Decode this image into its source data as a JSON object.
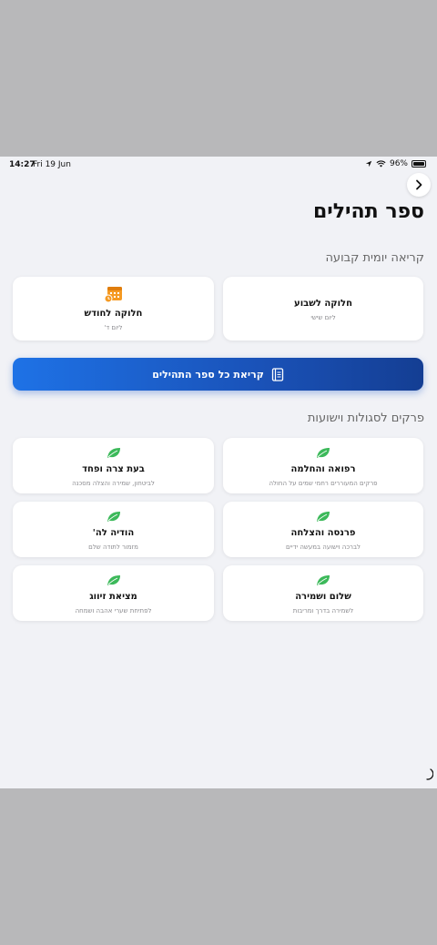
{
  "status": {
    "time": "14:27",
    "date": "Fri 19 Jun",
    "battery": "96%",
    "battery_level": 0.96
  },
  "header": {
    "title": "ספר תהילים"
  },
  "fixed_reading": {
    "title": "קריאה יומית קבועה",
    "cards": [
      {
        "title": "חלוקה לשבוע",
        "subtitle": "ליום שישי"
      },
      {
        "title": "חלוקה לחודש",
        "subtitle": "ליום ד'",
        "icon": "calendar-icon"
      }
    ]
  },
  "read_all": {
    "label": "קריאת כל ספר התהילים",
    "icon": "book-icon",
    "color_start": "#1e72e6",
    "color_end": "#143e93"
  },
  "segulot": {
    "title": "פרקים לסגולות וישועות",
    "icon_color": "#3cb95a",
    "cards": [
      {
        "title": "רפואה והחלמה",
        "subtitle": "פרקים המעוררים רחמי שמים על החולה"
      },
      {
        "title": "בעת צרה ופחד",
        "subtitle": "לביטחון, שמירה והצלה מסכנה"
      },
      {
        "title": "פרנסה והצלחה",
        "subtitle": "לברכה וישועה במעשה ידיים"
      },
      {
        "title": "הודיה לה'",
        "subtitle": "מזמור לתודה שלם"
      },
      {
        "title": "שלום ושמירה",
        "subtitle": "לשמירה בדרך ומריבות"
      },
      {
        "title": "מציאת זיווג",
        "subtitle": "לפתיחת שערי אהבה ושמחה"
      }
    ]
  }
}
